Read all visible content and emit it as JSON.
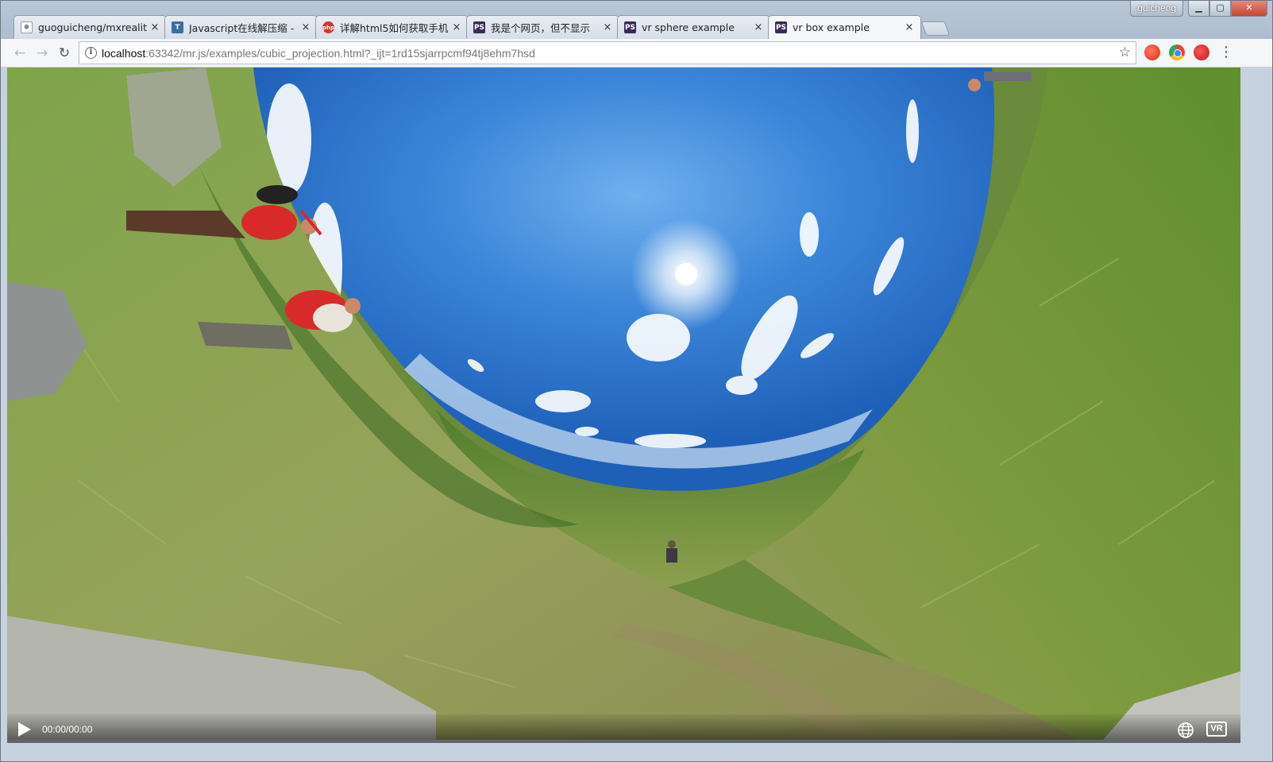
{
  "window": {
    "user_badge": "guicheng",
    "controls": [
      "minimize",
      "maximize",
      "close"
    ]
  },
  "tabs": [
    {
      "label": "guoguicheng/mxreality",
      "icon": "github-icon",
      "icon_bg": "#ffffff",
      "icon_color": "#222222",
      "active": false
    },
    {
      "label": "Javascript在线解压缩 - ",
      "icon": "t-icon",
      "icon_bg": "#3a6ea5",
      "icon_color": "#ffffff",
      "active": false
    },
    {
      "label": "详解html5如何获取手机",
      "icon": "php-icon",
      "icon_bg": "#d9312c",
      "icon_color": "#ffffff",
      "active": false
    },
    {
      "label": "我是个网页，但不显示",
      "icon": "phpstorm-icon",
      "icon_bg": "#3b2a5a",
      "icon_color": "#ffffff",
      "active": false
    },
    {
      "label": "vr sphere example",
      "icon": "phpstorm-icon",
      "icon_bg": "#3b2a5a",
      "icon_color": "#ffffff",
      "active": false
    },
    {
      "label": "vr box example",
      "icon": "phpstorm-icon",
      "icon_bg": "#3b2a5a",
      "icon_color": "#ffffff",
      "active": true
    }
  ],
  "tab_close_glyph": "×",
  "toolbar": {
    "back_glyph": "←",
    "forward_glyph": "→",
    "reload_glyph": "↻",
    "info_glyph": "i",
    "url_host": "localhost",
    "url_rest": ":63342/mr.js/examples/cubic_projection.html?_ijt=1rd15sjarrpcmf94tj8ehm7hsd",
    "star_glyph": "☆",
    "menu_glyph": "⋮"
  },
  "player": {
    "time": "00:00/00:00",
    "vr_label": "VR"
  },
  "colors": {
    "sky_top": "#1e5fb8",
    "sky_mid": "#3c86d9",
    "grass": "#6f9a3a",
    "accent_close": "#c64532"
  }
}
